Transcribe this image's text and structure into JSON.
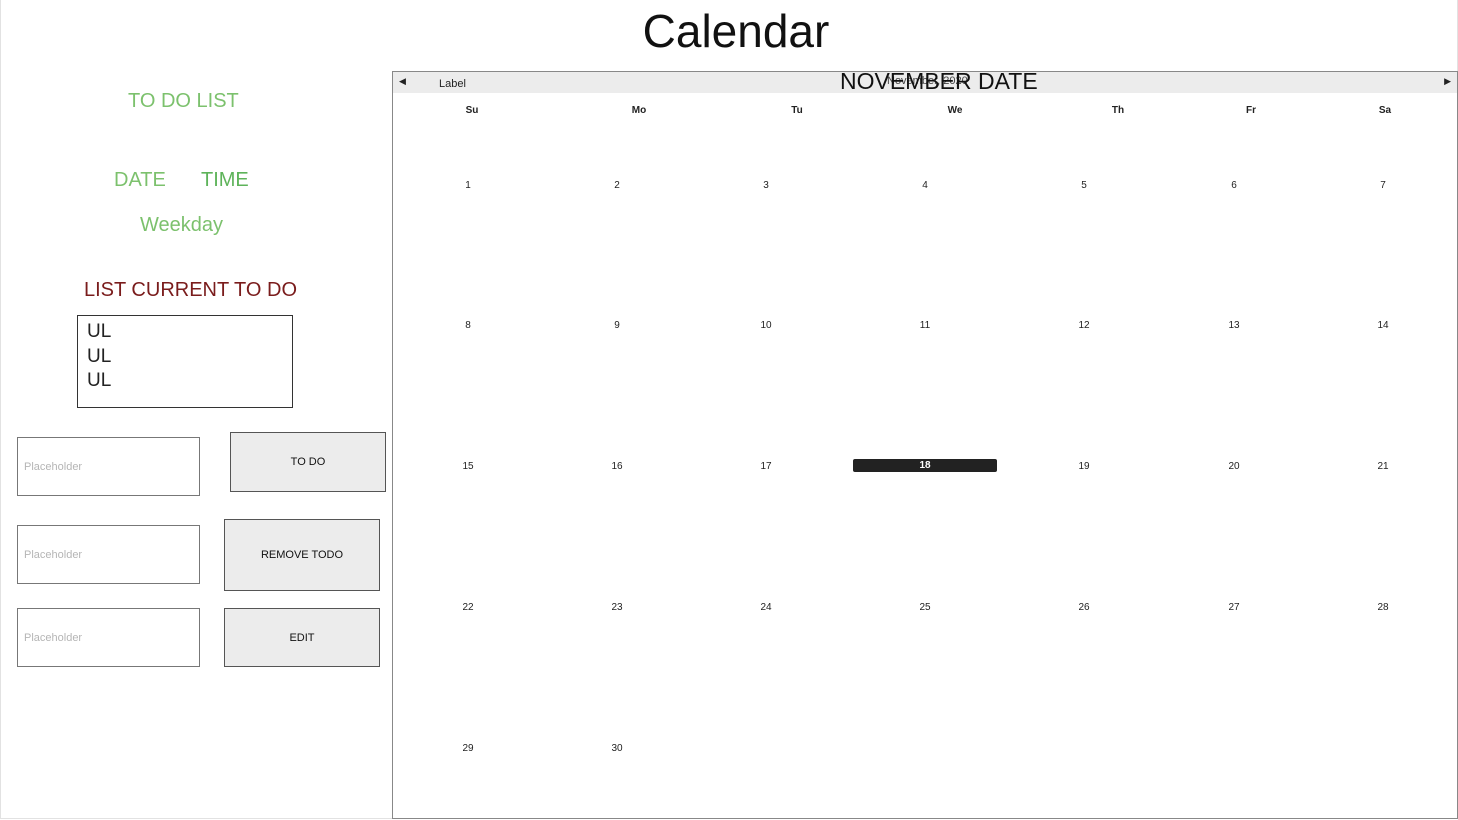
{
  "page": {
    "title": "Calendar"
  },
  "sidebar": {
    "todo_title": "TO DO LIST",
    "date_label": "DATE",
    "time_label": "TIME",
    "weekday_label": "Weekday",
    "current_title": "LIST CURRENT TO DO",
    "ul_items": [
      "UL",
      "UL",
      "UL"
    ],
    "inputs": [
      {
        "placeholder": "Placeholder",
        "value": ""
      },
      {
        "placeholder": "Placeholder",
        "value": ""
      },
      {
        "placeholder": "Placeholder",
        "value": ""
      }
    ],
    "buttons": {
      "todo": "TO DO",
      "remove": "REMOVE TODO",
      "edit": "EDIT"
    }
  },
  "calendar": {
    "label": "Label",
    "overlay_title": "NOVEMBER DATE",
    "month_year": "November, 2020",
    "prev_glyph": "◀",
    "next_glyph": "▶",
    "weekdays": [
      "Su",
      "Mo",
      "Tu",
      "We",
      "Th",
      "Fr",
      "Sa"
    ],
    "selected_day": 18,
    "weeks": [
      [
        "1",
        "2",
        "3",
        "4",
        "5",
        "6",
        "7"
      ],
      [
        "8",
        "9",
        "10",
        "11",
        "12",
        "13",
        "14"
      ],
      [
        "15",
        "16",
        "17",
        "18",
        "19",
        "20",
        "21"
      ],
      [
        "22",
        "23",
        "24",
        "25",
        "26",
        "27",
        "28"
      ],
      [
        "29",
        "30",
        "",
        "",
        "",
        "",
        ""
      ]
    ],
    "colors": {
      "header_bg": "#ececec",
      "selected_bg": "#222222"
    }
  }
}
